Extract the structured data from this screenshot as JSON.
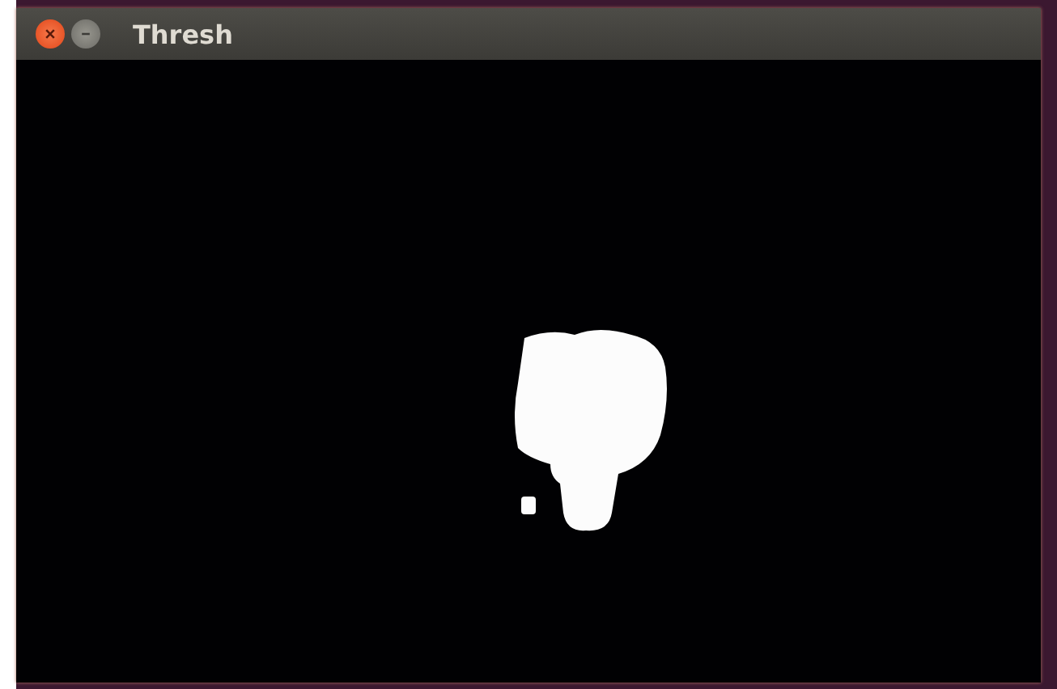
{
  "window": {
    "title": "Thresh"
  }
}
